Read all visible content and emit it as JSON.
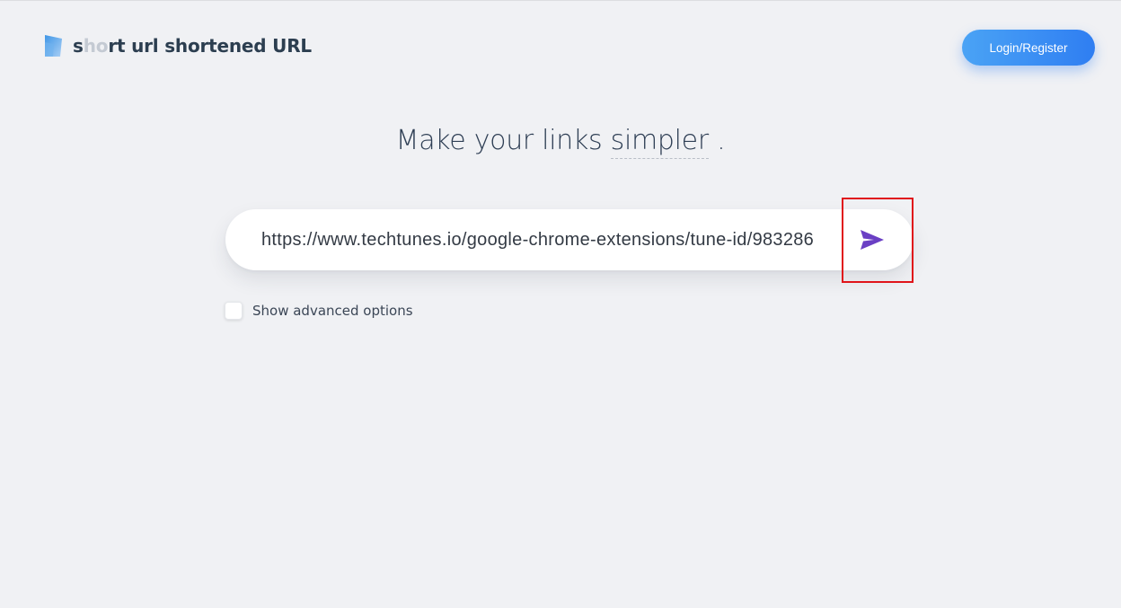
{
  "header": {
    "brand": {
      "prefix": "s",
      "dim": "ho",
      "rest": "rt url shortened URL",
      "logo_icon": "brand-logo-icon"
    },
    "login_label": "Login/Register"
  },
  "hero": {
    "headline_start": "Make your links ",
    "headline_accent": "simpler",
    "headline_end": " ."
  },
  "url_form": {
    "value": "https://www.techtunes.io/google-chrome-extensions/tune-id/983286",
    "send_icon": "send-icon"
  },
  "advanced": {
    "label": "Show advanced options",
    "checked": false
  },
  "colors": {
    "background": "#f0f1f4",
    "accent_button": "#2f7ef2",
    "send_icon": "#6a3fc4",
    "highlight": "#e0141a",
    "text": "#2c3e50"
  }
}
